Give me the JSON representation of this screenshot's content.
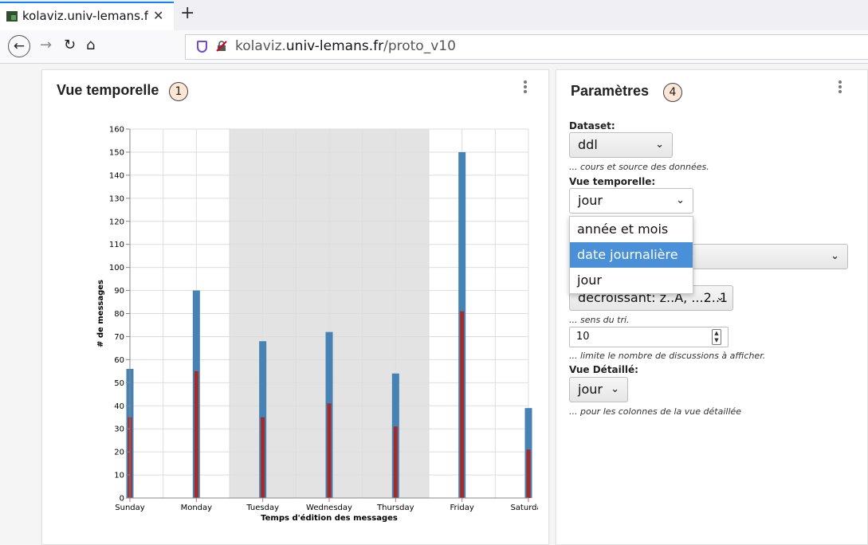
{
  "browser": {
    "tab_title": "kolaviz.univ-lemans.fr",
    "url_prefix": "kolaviz.",
    "url_domain": "univ-lemans.fr",
    "url_path": "/proto_v10"
  },
  "left_card": {
    "title": "Vue temporelle",
    "badge": "1"
  },
  "right_card": {
    "title": "Paramètres",
    "badge": "4",
    "dataset_label": "Dataset:",
    "dataset_value": "ddl",
    "dataset_hint": "... cours et source des données.",
    "vue_label": "Vue temporelle:",
    "vue_value": "jour",
    "vue_options": [
      "année et mois",
      "date journalière",
      "jour"
    ],
    "vue_highlighted": "date journalière",
    "sort_value": "décroissant: z..A, ...2..1",
    "sort_hint": "... sens du tri.",
    "limit_value": "10",
    "limit_hint": "... limite le nombre de discussions à afficher.",
    "detail_label": "Vue Détaillé:",
    "detail_value": "jour",
    "detail_hint": "... pour les colonnes de la vue détaillée"
  },
  "chart_data": {
    "type": "bar",
    "categories": [
      "Sunday",
      "Monday",
      "Tuesday",
      "Wednesday",
      "Thursday",
      "Friday",
      "Saturday"
    ],
    "series": [
      {
        "values": [
          56,
          90,
          68,
          72,
          54,
          150,
          39
        ],
        "color": "#4682b4"
      },
      {
        "values": [
          35,
          55,
          35,
          41,
          31,
          81,
          21
        ],
        "color": "#a52a2a"
      }
    ],
    "xlabel": "Temps d'édition des messages",
    "ylabel": "# de messages",
    "ylim": [
      0,
      160
    ],
    "yticks": [
      0,
      10,
      20,
      30,
      40,
      50,
      60,
      70,
      80,
      90,
      100,
      110,
      120,
      130,
      140,
      150,
      160
    ],
    "highlight_band": [
      "Tuesday",
      "Thursday"
    ],
    "band_color": "#e3e3e3",
    "grid": true
  }
}
